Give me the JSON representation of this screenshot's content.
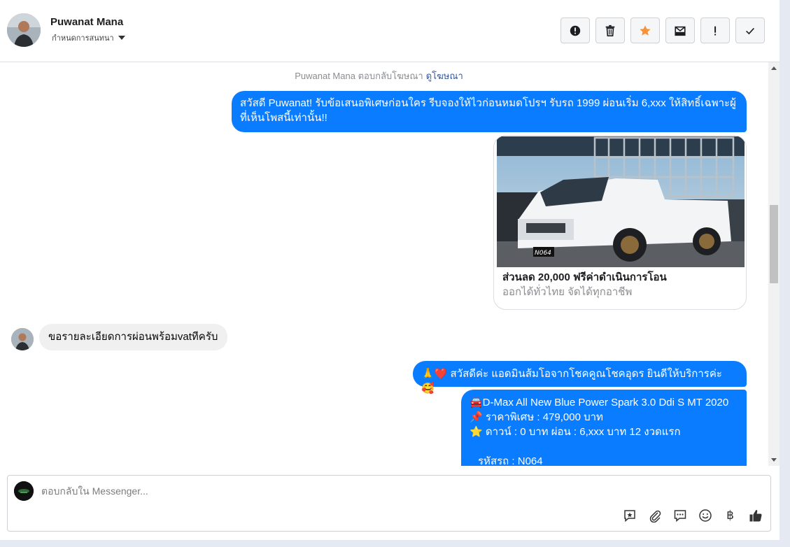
{
  "header": {
    "name": "Puwanat Mana",
    "assign_label": "กำหนดการสนทนา",
    "toolbar": [
      "spam-icon",
      "trash-icon",
      "star-icon",
      "archive-icon",
      "important-icon",
      "done-icon"
    ]
  },
  "conversation": {
    "meta_text": "Puwanat Mana ตอบกลับโฆษณา",
    "meta_link": "ดูโฆษณา",
    "msg1": "สวัสดี Puwanat! รับข้อเสนอพิเศษก่อนใคร รีบจองให้ไวก่อนหมดโปรฯ รับรถ 1999 ผ่อนเริ่ม 6,xxx ให้สิทธิ์เฉพาะผู้ที่เห็นโพสนี้เท่านั้น!!",
    "card": {
      "title": "ส่วนลด 20,000 ฟรีค่าดำเนินการโอน",
      "subtitle": "ออกได้ทั่วไทย จัดได้ทุกอาชีพ",
      "plate": "N064"
    },
    "incoming": "ขอรายละเอียดการผ่อนพร้อมvatทีครับ",
    "msg2": "🙏❤️ สวัสดีค่ะ แอดมินส้มโอจากโชคคูณโชคอุดร ยินดีให้บริการค่ะ 🥰.",
    "msg3_lines": [
      "🚘D-Max All New Blue Power Spark 3.0 Ddi S MT 2020",
      "📌 ราคาพิเศษ : 479,000 บาท",
      "⭐ ดาวน์ : 0 บาท ผ่อน : 6,xxx บาท 12 งวดแรก",
      "",
      "  รหัสรถ : N064"
    ]
  },
  "composer": {
    "placeholder": "ตอบกลับใน Messenger...",
    "tools": [
      "saved-reply-icon",
      "attach-icon",
      "quick-reply-icon",
      "emoji-icon",
      "payment-icon",
      "like-icon"
    ],
    "currency_symbol": "฿"
  },
  "colors": {
    "accent": "#0a7cff",
    "star": "#f7923a"
  }
}
